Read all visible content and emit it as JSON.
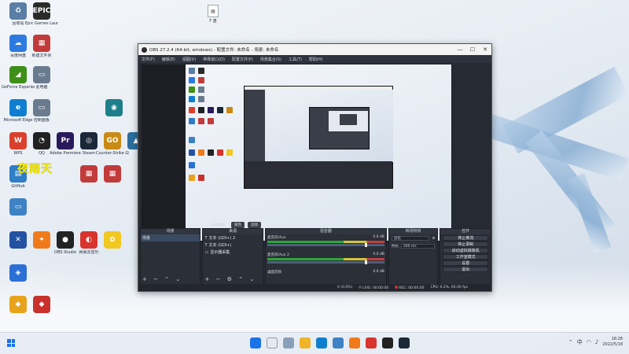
{
  "desktop": {
    "icons": [
      {
        "label": "回收站",
        "glyph": "♻",
        "color": "#5a7fa6"
      },
      {
        "label": "Epic Games Launcher",
        "glyph": "EPIC",
        "color": "#2a2a2a"
      },
      {
        "label": "百度网盘",
        "glyph": "☁",
        "color": "#2d7be0"
      },
      {
        "label": "新建文件夹",
        "glyph": "▦",
        "color": "#c23b3b"
      },
      {
        "label": "GeForce Experience",
        "glyph": "◢",
        "color": "#3e8f17"
      },
      {
        "label": "此电脑",
        "glyph": "▭",
        "color": "#6b7b8f"
      },
      {
        "label": "Microsoft Edge",
        "glyph": "e",
        "color": "#0e7fd0"
      },
      {
        "label": "控制面板",
        "glyph": "▭",
        "color": "#6b7b8f"
      },
      {
        "label": "",
        "glyph": "◉",
        "color": "#1d7f8a"
      },
      {
        "label": "WPS",
        "glyph": "W",
        "color": "#d9412e"
      },
      {
        "label": "QQ",
        "glyph": "◔",
        "color": "#222"
      },
      {
        "label": "Adobe Premiere",
        "glyph": "Pr",
        "color": "#2a1a5c"
      },
      {
        "label": "Steam",
        "glyph": "◎",
        "color": "#1b2838"
      },
      {
        "label": "Counter-Strike Global Off",
        "glyph": "GO",
        "color": "#c98a16"
      },
      {
        "label": "",
        "glyph": "▲",
        "color": "#2b6f9e"
      },
      {
        "label": "GitHub",
        "glyph": "▤",
        "color": "#2f7ec6"
      },
      {
        "label": "",
        "glyph": "▦",
        "color": "#c23b3b"
      },
      {
        "label": "",
        "glyph": "▦",
        "color": "#c23b3b"
      },
      {
        "label": "",
        "glyph": "▭",
        "color": "#3d82c3"
      },
      {
        "label": "",
        "glyph": "✕",
        "color": "#2352a3"
      },
      {
        "label": "",
        "glyph": "✦",
        "color": "#f07a1a"
      },
      {
        "label": "OBS Studio",
        "glyph": "●",
        "color": "#222"
      },
      {
        "label": "网易云音乐",
        "glyph": "◐",
        "color": "#d9332e"
      },
      {
        "label": "",
        "glyph": "✿",
        "color": "#f0c820"
      },
      {
        "label": "",
        "glyph": "◈",
        "color": "#2b6fd6"
      },
      {
        "label": "",
        "glyph": "◆",
        "color": "#e8a21c"
      },
      {
        "label": "",
        "glyph": "◆",
        "color": "#c9302c"
      }
    ],
    "watermark": "夜雨天",
    "top_file": {
      "label": "F 盘"
    }
  },
  "obs": {
    "title": "OBS 27.2.4 (64-bit, windows) - 配置文件: 未命名 - 场景: 未命名",
    "menu": [
      "文件(F)",
      "编辑(E)",
      "视图(V)",
      "停靠窗口(D)",
      "配置文件(P)",
      "场景集合(S)",
      "工具(T)",
      "帮助(H)"
    ],
    "preview_tabs": [
      "属性",
      "滤镜"
    ],
    "no_source_selected": "未选择源",
    "docks": {
      "scenes": {
        "title": "场景",
        "items": [
          "场景"
        ]
      },
      "sources": {
        "title": "来源",
        "items": [
          "文本 (GDI+) 2",
          "文本 (GDI+)",
          "显示器采集"
        ]
      },
      "mixer": {
        "title": "混音器",
        "channels": [
          {
            "name": "麦克风/Aux",
            "db": "0.0 dB"
          },
          {
            "name": "麦克风/Aux 2",
            "db": "0.0 dB"
          },
          {
            "name": "桌面音频",
            "db": "0.0 dB"
          }
        ]
      },
      "transitions": {
        "title": "转场特效",
        "type": "淡化",
        "duration_label": "时长",
        "duration": "300 ms"
      },
      "controls": {
        "title": "控件",
        "buttons": [
          "停止推流",
          "停止录制",
          "启动虚拟摄像机",
          "工作室模式",
          "设置",
          "退出"
        ]
      }
    },
    "status": {
      "live": "LIVE: 00:00:00",
      "rec": "REC: 00:00:00",
      "cpu": "CPU: 0.2%, 60.00 fps",
      "dropped": "0 (0.0%)"
    }
  },
  "taskbar": {
    "time": "18:28",
    "date": "2022/5/18",
    "tray_lang": "中"
  }
}
